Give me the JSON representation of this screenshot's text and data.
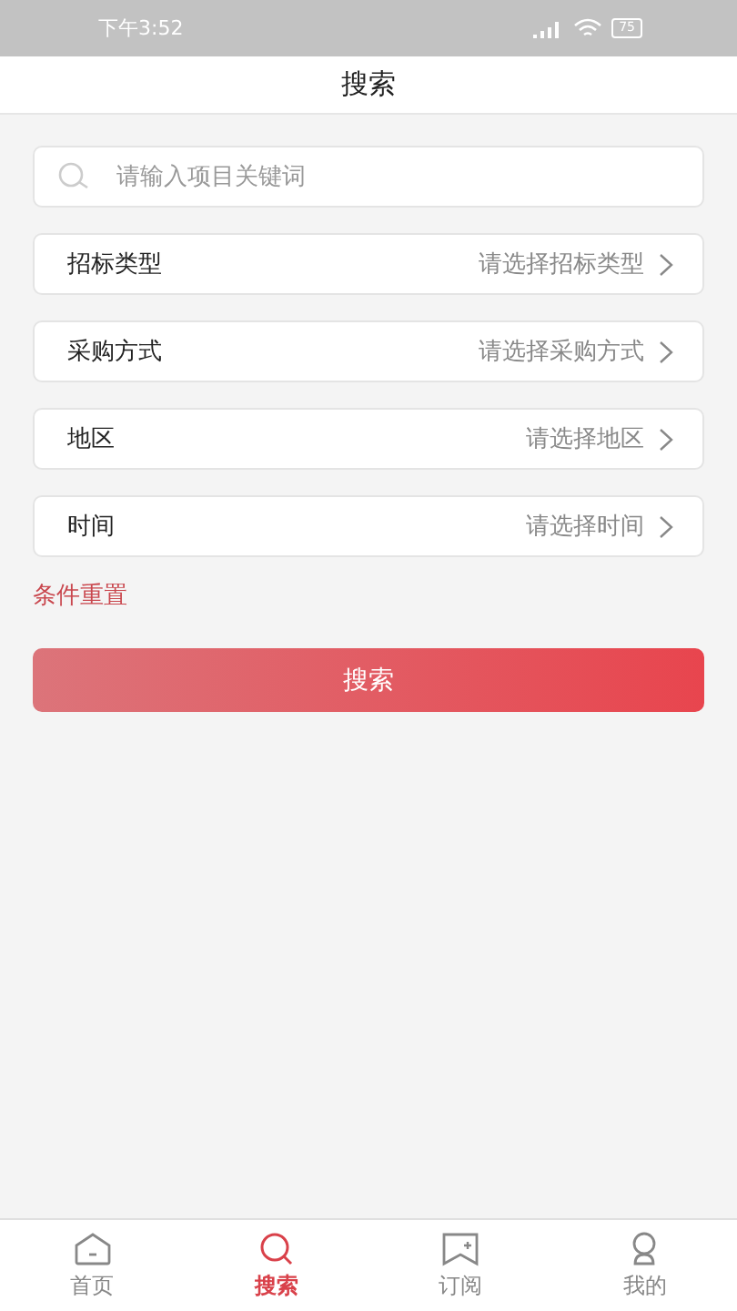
{
  "status_bar": {
    "time": "下午3:52",
    "battery": "75"
  },
  "header": {
    "title": "搜索"
  },
  "search": {
    "placeholder": "请输入项目关键词"
  },
  "filters": [
    {
      "label": "招标类型",
      "placeholder": "请选择招标类型"
    },
    {
      "label": "采购方式",
      "placeholder": "请选择采购方式"
    },
    {
      "label": "地区",
      "placeholder": "请选择地区"
    },
    {
      "label": "时间",
      "placeholder": "请选择时间"
    }
  ],
  "reset_link": "条件重置",
  "search_button": "搜索",
  "tabs": [
    {
      "kind": "home",
      "label": "首页",
      "selected": false
    },
    {
      "kind": "search",
      "label": "搜索",
      "selected": true
    },
    {
      "kind": "subscribe",
      "label": "订阅",
      "selected": false
    },
    {
      "kind": "me",
      "label": "我的",
      "selected": false
    }
  ]
}
